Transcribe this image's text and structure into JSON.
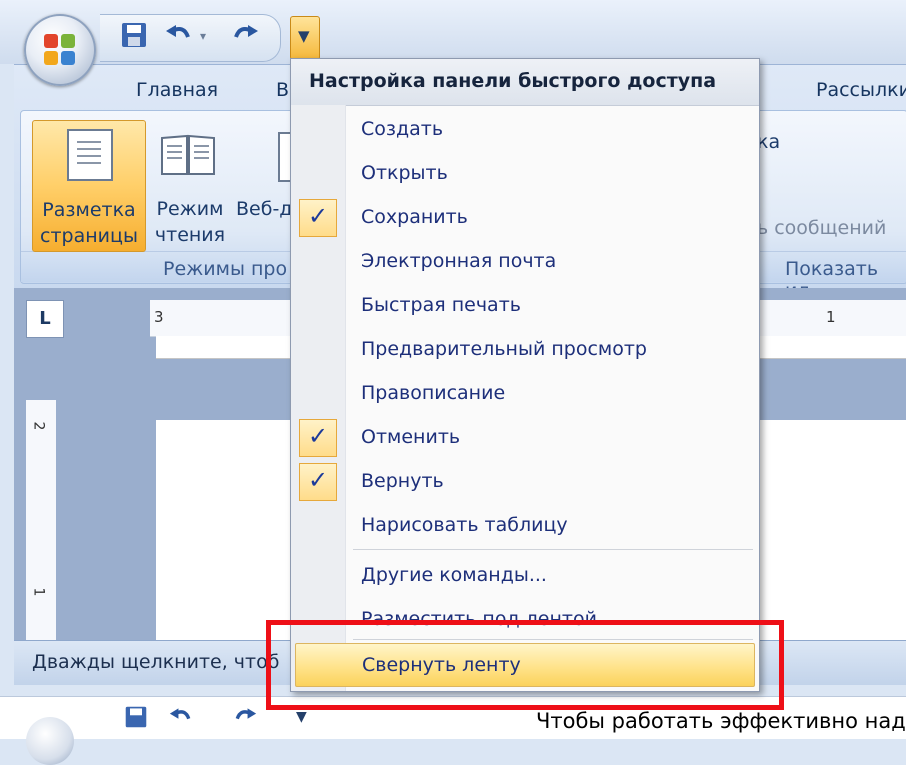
{
  "ribbon": {
    "tabs": [
      "Главная",
      "В",
      "Рассылки"
    ],
    "buttons": {
      "page_layout": [
        "Разметка",
        "страницы"
      ],
      "read_mode": [
        "Режим",
        "чтения"
      ],
      "web_doc": "Веб-д"
    },
    "group_views_label": "Режимы про",
    "group_show_label": "Показать ил",
    "partial_messages": "ь сообщений",
    "partial_ka": "ка"
  },
  "ruler": {
    "corner": "L",
    "h_labels": [
      "3",
      "1"
    ],
    "v_labels": [
      "2",
      "1"
    ]
  },
  "status_bar": {
    "text": "Дважды щелкните, чтоб"
  },
  "second_window": {
    "title_text": "Чтобы работать эффективно надс"
  },
  "qat_menu": {
    "title": "Настройка панели быстрого доступа",
    "items": [
      {
        "label": "Создать",
        "checked": false
      },
      {
        "label": "Открыть",
        "checked": false
      },
      {
        "label": "Сохранить",
        "checked": true
      },
      {
        "label": "Электронная почта",
        "checked": false
      },
      {
        "label": "Быстрая печать",
        "checked": false
      },
      {
        "label": "Предварительный просмотр",
        "checked": false
      },
      {
        "label": "Правописание",
        "checked": false
      },
      {
        "label": "Отменить",
        "checked": true
      },
      {
        "label": "Вернуть",
        "checked": true
      },
      {
        "label": "Нарисовать таблицу",
        "checked": false
      }
    ],
    "more_commands": "Другие команды...",
    "place_below": "Разместить под лентой",
    "minimize_ribbon": "Свернуть ленту"
  },
  "colors": {
    "highlight_box": "#ee0f17",
    "menu_text": "#1d2f7a",
    "ribbon_active": "#ffcf69"
  },
  "icons": [
    "office-orb-icon",
    "save-icon",
    "undo-icon",
    "redo-icon",
    "qat-dropdown-icon",
    "checkmark-icon"
  ]
}
